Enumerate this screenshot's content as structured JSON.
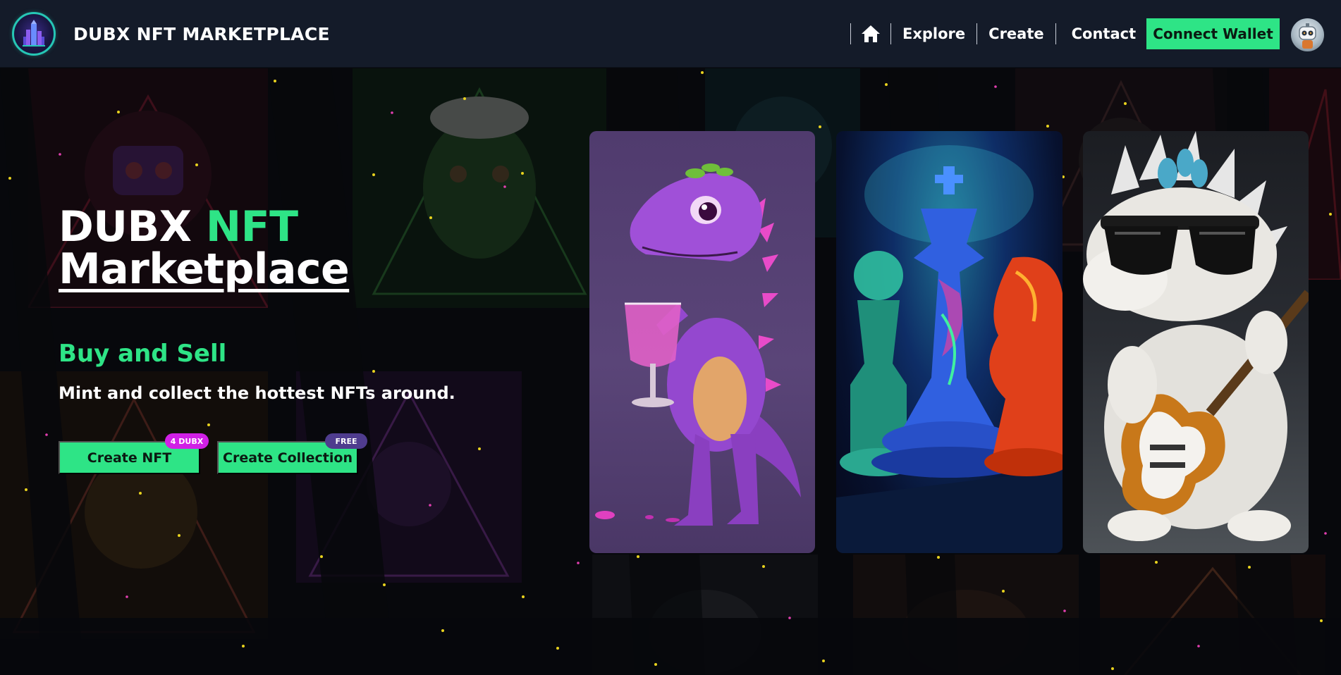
{
  "navbar": {
    "brand": "DUBX NFT MARKETPLACE",
    "links": [
      "Explore",
      "Create",
      "Contact"
    ],
    "connect_wallet": "Connect Wallet",
    "icons": {
      "logo": "dubx-logo-icon",
      "home": "home-icon",
      "avatar": "robot-avatar-icon"
    }
  },
  "hero": {
    "title_part1": "DUBX ",
    "title_accent": "NFT",
    "title_line2": "Marketplace",
    "subtitle": "Buy and Sell",
    "description": "Mint and collect the hottest NFTs around.",
    "buttons": {
      "create_nft": "Create NFT",
      "create_nft_badge": "4 DUBX",
      "create_collection": "Create Collection",
      "create_collection_badge": "FREE"
    }
  },
  "featured_cards": [
    {
      "subject": "purple-dinosaur-with-goblet"
    },
    {
      "subject": "glowing-chess-pieces"
    },
    {
      "subject": "white-dragon-with-sunglasses-and-guitar"
    }
  ],
  "colors": {
    "accent": "#2ee486",
    "navbar_bg": "#141b29",
    "page_bg": "#07080c",
    "badge_dubx": "#d020e6",
    "badge_free": "#4f3c8e"
  }
}
